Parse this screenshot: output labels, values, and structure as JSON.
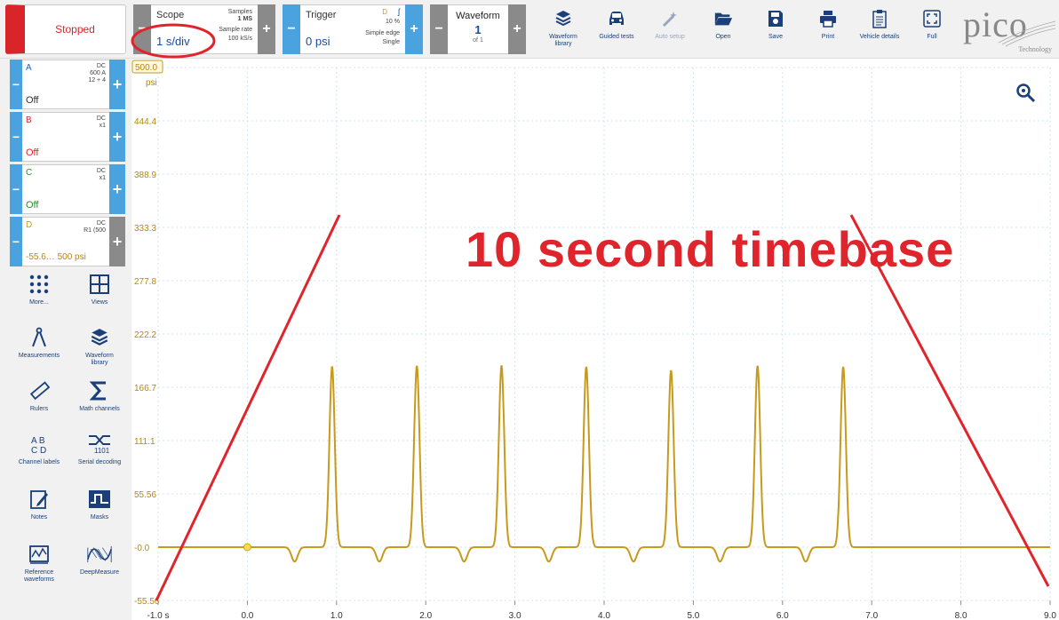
{
  "run_button": {
    "label": "Stopped"
  },
  "scope": {
    "title": "Scope",
    "timebase": "1 s/div",
    "samples_label": "Samples",
    "samples_value": "1 MS",
    "rate_label": "Sample rate",
    "rate_value": "100 kS/s",
    "minus": "−",
    "plus": "+"
  },
  "trigger": {
    "title": "Trigger",
    "source": "D",
    "edge_glyph": "ʃ",
    "pretrigger": "10 %",
    "threshold": "0 psi",
    "type": "Simple edge",
    "mode": "Single",
    "minus": "−",
    "plus": "+"
  },
  "waveform": {
    "title": "Waveform",
    "index": "1",
    "of": "of 1",
    "minus": "−",
    "plus": "+"
  },
  "toolbar": [
    {
      "label": "Waveform\nlibrary",
      "icon": "waveform-library-icon",
      "enabled": true
    },
    {
      "label": "Guided tests",
      "icon": "car-icon",
      "enabled": true
    },
    {
      "label": "Auto setup",
      "icon": "magic-wand-icon",
      "enabled": false
    },
    {
      "label": "Open",
      "icon": "folder-icon",
      "enabled": true
    },
    {
      "label": "Save",
      "icon": "save-icon",
      "enabled": true
    },
    {
      "label": "Print",
      "icon": "printer-icon",
      "enabled": true
    },
    {
      "label": "Vehicle details",
      "icon": "clipboard-icon",
      "enabled": true
    },
    {
      "label": "Full",
      "icon": "fullscreen-icon",
      "enabled": true
    }
  ],
  "logo": {
    "word": "pico",
    "sub": "Technology"
  },
  "channels": [
    {
      "name": "A",
      "coupling": "DC",
      "probe": "600 A",
      "extra": "12 + 4",
      "range": "Off",
      "color": "#1b62c2",
      "range_color": "#1b62c2"
    },
    {
      "name": "B",
      "coupling": "DC",
      "probe": "x1",
      "extra": "",
      "range": "Off",
      "color": "#d9252a",
      "range_color": "#d9252a"
    },
    {
      "name": "C",
      "coupling": "DC",
      "probe": "x1",
      "extra": "",
      "range": "Off",
      "color": "#2e8b2e",
      "range_color": "#2e8b2e"
    },
    {
      "name": "D",
      "coupling": "DC",
      "probe": "R1 (500",
      "extra": "",
      "range": "-55.6… 500 psi",
      "color": "#c79a1c",
      "range_color": "#b8870b"
    }
  ],
  "channel_buttons": {
    "minus": "−",
    "plus": "+"
  },
  "side_tools": [
    {
      "label": "More...",
      "icon": "more-icon"
    },
    {
      "label": "Views",
      "icon": "views-icon"
    },
    {
      "label": "Measurements",
      "icon": "measurements-icon"
    },
    {
      "label": "Waveform\nlibrary",
      "icon": "waveform-library-icon"
    },
    {
      "label": "Rulers",
      "icon": "ruler-icon"
    },
    {
      "label": "Math channels",
      "icon": "sigma-icon"
    },
    {
      "label": "Channel labels",
      "icon": "channel-labels-icon"
    },
    {
      "label": "Serial decoding",
      "icon": "serial-decoding-icon"
    },
    {
      "label": "Notes",
      "icon": "notes-icon"
    },
    {
      "label": "Masks",
      "icon": "masks-icon"
    },
    {
      "label": "Reference\nwaveforms",
      "icon": "reference-waveforms-icon"
    },
    {
      "label": "DeepMeasure",
      "icon": "deepmeasure-icon"
    }
  ],
  "annotation": {
    "text": "10 second timebase",
    "color": "#e0242b"
  },
  "chart_data": {
    "type": "line",
    "title": "",
    "xlabel": "s",
    "ylabel": "psi",
    "xlim": [
      -1.0,
      9.0
    ],
    "ylim": [
      -55.56,
      500.0
    ],
    "x_ticks": [
      "-1.0",
      "0.0",
      "1.0",
      "2.0",
      "3.0",
      "4.0",
      "5.0",
      "6.0",
      "7.0",
      "8.0",
      "9.0"
    ],
    "y_ticks": [
      "500.0",
      "444.4",
      "388.9",
      "333.3",
      "277.8",
      "222.2",
      "166.7",
      "111.1",
      "55.56",
      "-0.0",
      "-55.56"
    ],
    "y_top_label": "500.0",
    "y_unit": "psi",
    "x_unit": "s",
    "grid": true,
    "series": [
      {
        "color": "#c79a1c",
        "baseline": 0,
        "pulse_times": [
          0.95,
          1.9,
          2.85,
          3.8,
          4.75,
          5.72,
          6.68
        ],
        "pulse_peaks": [
          188,
          189,
          189,
          188,
          184,
          189,
          188
        ],
        "dip": -15
      }
    ],
    "trigger_marker": {
      "x": 0.0,
      "y": 0
    }
  }
}
